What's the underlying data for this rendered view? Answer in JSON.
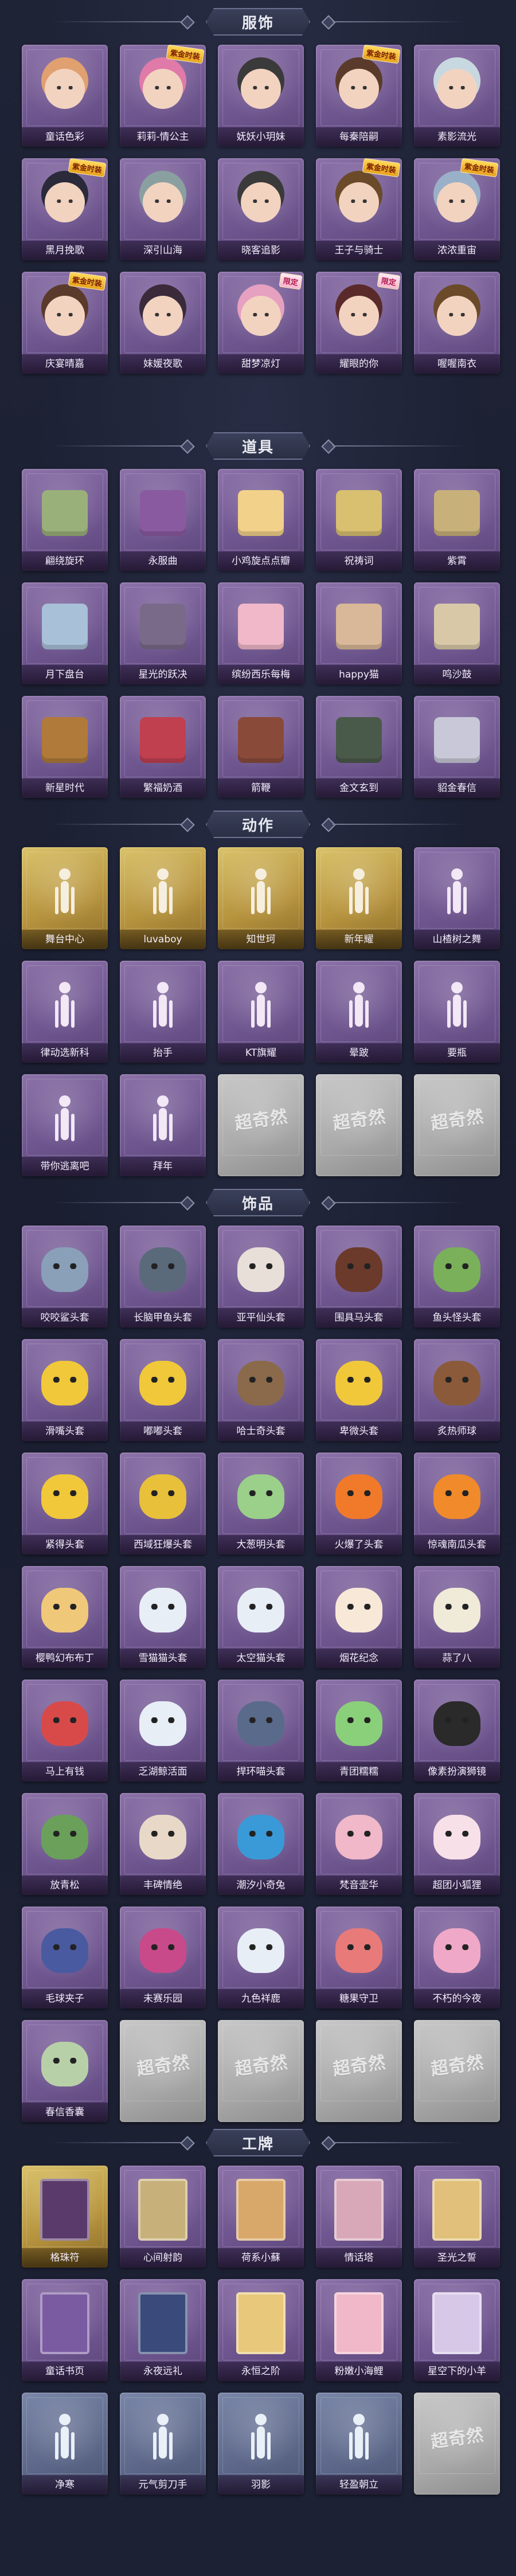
{
  "sections": [
    {
      "title": "服饰",
      "items": [
        {
          "label": "童话色彩",
          "style": "purple",
          "art": "face",
          "color": "#e0a070"
        },
        {
          "label": "莉莉-情公主",
          "style": "purple",
          "art": "face",
          "color": "#e07aa8",
          "badge": "紫金时装"
        },
        {
          "label": "妩妖小玥妹",
          "style": "purple",
          "art": "face",
          "color": "#3a3a3a"
        },
        {
          "label": "每秦陪嗣",
          "style": "purple",
          "art": "face",
          "color": "#5a3a2a",
          "badge": "紫金时装"
        },
        {
          "label": "素影流光",
          "style": "purple",
          "art": "face",
          "color": "#c8d8e0"
        },
        {
          "label": "黑月挽歌",
          "style": "purple",
          "art": "face",
          "color": "#2a2a3a",
          "badge": "紫金时装"
        },
        {
          "label": "深引山海",
          "style": "purple",
          "art": "face",
          "color": "#8aa0a0"
        },
        {
          "label": "晓客追影",
          "style": "purple",
          "art": "face",
          "color": "#3a3a3a"
        },
        {
          "label": "王子与骑士",
          "style": "purple",
          "art": "face",
          "color": "#6b4a2a",
          "badge": "紫金时装"
        },
        {
          "label": "浓浓重宙",
          "style": "purple",
          "art": "face",
          "color": "#9ab0c8",
          "badge": "紫金时装"
        },
        {
          "label": "庆宴晴嘉",
          "style": "purple",
          "art": "face",
          "color": "#5a3a2a",
          "badge": "紫金时装"
        },
        {
          "label": "妹媛夜歌",
          "style": "purple",
          "art": "face",
          "color": "#3a2a3a"
        },
        {
          "label": "甜梦凉灯",
          "style": "purple",
          "art": "face",
          "color": "#e6a0c0",
          "badge": "限定"
        },
        {
          "label": "耀眼的你",
          "style": "purple",
          "art": "face",
          "color": "#5a2a2a",
          "badge": "限定"
        },
        {
          "label": "喔喔南衣",
          "style": "purple",
          "art": "face",
          "color": "#6b4a2a"
        }
      ]
    },
    {
      "title": "道具",
      "items": [
        {
          "label": "翩绕旋环",
          "style": "purple",
          "art": "prop",
          "color": "#9ab07a"
        },
        {
          "label": "永服曲",
          "style": "purple",
          "art": "prop",
          "color": "#8a5aa0"
        },
        {
          "label": "小鸡旋点点瓣",
          "style": "purple",
          "art": "prop",
          "color": "#f2d28a"
        },
        {
          "label": "祝祷词",
          "style": "purple",
          "art": "prop",
          "color": "#d8c070"
        },
        {
          "label": "紫霄",
          "style": "purple",
          "art": "prop",
          "color": "#c8b07a"
        },
        {
          "label": "月下盘台",
          "style": "purple",
          "art": "prop",
          "color": "#a8c0d8"
        },
        {
          "label": "星光的跃决",
          "style": "purple",
          "art": "prop",
          "color": "#7a6a8a"
        },
        {
          "label": "缤纷西乐每梅",
          "style": "purple",
          "art": "prop",
          "color": "#f0b8c8"
        },
        {
          "label": "happy猫",
          "style": "purple",
          "art": "prop",
          "color": "#d8b898"
        },
        {
          "label": "鸣沙鼓",
          "style": "purple",
          "art": "prop",
          "color": "#d8c8a8"
        },
        {
          "label": "新星时代",
          "style": "purple",
          "art": "prop",
          "color": "#b07a3a"
        },
        {
          "label": "繁福奶酒",
          "style": "purple",
          "art": "prop",
          "color": "#c04050"
        },
        {
          "label": "箭鞭",
          "style": "purple",
          "art": "prop",
          "color": "#8a4a3a"
        },
        {
          "label": "金文玄到",
          "style": "purple",
          "art": "prop",
          "color": "#4a5a4a"
        },
        {
          "label": "貂金春信",
          "style": "purple",
          "art": "prop",
          "color": "#c8c8d8"
        }
      ]
    },
    {
      "title": "动作",
      "items": [
        {
          "label": "舞台中心",
          "style": "gold",
          "art": "pose",
          "color": "#f6efe0"
        },
        {
          "label": "luvaboy",
          "style": "gold",
          "art": "pose",
          "color": "#f6efe0"
        },
        {
          "label": "知世珂",
          "style": "gold",
          "art": "pose",
          "color": "#f6efe0"
        },
        {
          "label": "新年耀",
          "style": "gold",
          "art": "pose",
          "color": "#f6efe0"
        },
        {
          "label": "山楂树之舞",
          "style": "purple",
          "art": "pose",
          "color": "#f2e8f6"
        },
        {
          "label": "律动选新科",
          "style": "purple",
          "art": "pose",
          "color": "#f2e8f6"
        },
        {
          "label": "抬手",
          "style": "purple",
          "art": "pose",
          "color": "#f2e8f6"
        },
        {
          "label": "KT旗耀",
          "style": "purple",
          "art": "pose",
          "color": "#f2e8f6"
        },
        {
          "label": "晕跛",
          "style": "purple",
          "art": "pose",
          "color": "#f2e8f6"
        },
        {
          "label": "要瓶",
          "style": "purple",
          "art": "pose",
          "color": "#f2e8f6"
        },
        {
          "label": "带你逃离吧",
          "style": "purple",
          "art": "pose",
          "color": "#f2e8f6"
        },
        {
          "label": "拜年",
          "style": "purple",
          "art": "pose",
          "color": "#f2e8f6"
        },
        {
          "label": "",
          "style": "gray",
          "art": "wm",
          "wm": "超奇然"
        },
        {
          "label": "",
          "style": "gray",
          "art": "wm",
          "wm": "超奇然"
        },
        {
          "label": "",
          "style": "gray",
          "art": "wm",
          "wm": "超奇然"
        }
      ]
    },
    {
      "title": "饰品",
      "items": [
        {
          "label": "咬咬鲨头套",
          "style": "purple",
          "art": "mask",
          "color": "#8aa0b8"
        },
        {
          "label": "长脑甲鱼头套",
          "style": "purple",
          "art": "mask",
          "color": "#5a6a7a"
        },
        {
          "label": "亚平仙头套",
          "style": "purple",
          "art": "mask",
          "color": "#e8e0d8"
        },
        {
          "label": "围具马头套",
          "style": "purple",
          "art": "mask",
          "color": "#6b3a2a"
        },
        {
          "label": "鱼头怪头套",
          "style": "purple",
          "art": "mask",
          "color": "#7ab05a"
        },
        {
          "label": "滑嘴头套",
          "style": "purple",
          "art": "mask",
          "color": "#f0c83a"
        },
        {
          "label": "嘟嘟头套",
          "style": "purple",
          "art": "mask",
          "color": "#f0c83a"
        },
        {
          "label": "哈士奇头套",
          "style": "purple",
          "art": "mask",
          "color": "#8a6a4a"
        },
        {
          "label": "卑微头套",
          "style": "purple",
          "art": "mask",
          "color": "#f0c83a"
        },
        {
          "label": "炙热师球",
          "style": "purple",
          "art": "mask",
          "color": "#8a5a3a"
        },
        {
          "label": "紧得头套",
          "style": "purple",
          "art": "mask",
          "color": "#f0c83a"
        },
        {
          "label": "西域狂爆头套",
          "style": "purple",
          "art": "mask",
          "color": "#e8c03a"
        },
        {
          "label": "大葱明头套",
          "style": "purple",
          "art": "mask",
          "color": "#9ad08a"
        },
        {
          "label": "火爆了头套",
          "style": "purple",
          "art": "mask",
          "color": "#f07a2a"
        },
        {
          "label": "惊魂南瓜头套",
          "style": "purple",
          "art": "mask",
          "color": "#f08a2a"
        },
        {
          "label": "樱鸭幻布布丁",
          "style": "purple",
          "art": "mask",
          "color": "#f0c87a"
        },
        {
          "label": "雪猫猫头套",
          "style": "purple",
          "art": "mask",
          "color": "#e8eef6"
        },
        {
          "label": "太空猫头套",
          "style": "purple",
          "art": "mask",
          "color": "#e8eef6"
        },
        {
          "label": "烟花纪念",
          "style": "purple",
          "art": "mask",
          "color": "#f8e8d8"
        },
        {
          "label": "蒜了八",
          "style": "purple",
          "art": "mask",
          "color": "#f0ead8"
        },
        {
          "label": "马上有钱",
          "style": "purple",
          "art": "mask",
          "color": "#d84a4a"
        },
        {
          "label": "乏湖鲸活面",
          "style": "purple",
          "art": "mask",
          "color": "#e8eef6"
        },
        {
          "label": "捍环喵头套",
          "style": "purple",
          "art": "mask",
          "color": "#5a6a8a"
        },
        {
          "label": "青团糯糯",
          "style": "purple",
          "art": "mask",
          "color": "#8ad07a"
        },
        {
          "label": "像素扮演狮镜",
          "style": "purple",
          "art": "mask",
          "color": "#2a2a2a"
        },
        {
          "label": "放青松",
          "style": "purple",
          "art": "mask",
          "color": "#6aa05a"
        },
        {
          "label": "丰碑情绝",
          "style": "purple",
          "art": "mask",
          "color": "#e8d8c8"
        },
        {
          "label": "潮汐小奇兔",
          "style": "purple",
          "art": "mask",
          "color": "#3a9ad8"
        },
        {
          "label": "梵音壶华",
          "style": "purple",
          "art": "mask",
          "color": "#f0b8c8"
        },
        {
          "label": "超团小狐狸",
          "style": "purple",
          "art": "mask",
          "color": "#f8e0e8"
        },
        {
          "label": "毛球夹子",
          "style": "purple",
          "art": "mask",
          "color": "#4a5aa0"
        },
        {
          "label": "未赛乐园",
          "style": "purple",
          "art": "mask",
          "color": "#c84a8a"
        },
        {
          "label": "九色祥鹿",
          "style": "purple",
          "art": "mask",
          "color": "#e8eef6"
        },
        {
          "label": "糖果守卫",
          "style": "purple",
          "art": "mask",
          "color": "#e87a7a"
        },
        {
          "label": "不朽的今夜",
          "style": "purple",
          "art": "mask",
          "color": "#f0a8c8"
        },
        {
          "label": "春信香囊",
          "style": "purple",
          "art": "mask",
          "color": "#b8d0a8"
        },
        {
          "label": "",
          "style": "gray",
          "art": "wm",
          "wm": "超奇然"
        },
        {
          "label": "",
          "style": "gray",
          "art": "wm",
          "wm": "超奇然"
        },
        {
          "label": "",
          "style": "gray",
          "art": "wm",
          "wm": "超奇然"
        },
        {
          "label": "",
          "style": "gray",
          "art": "wm",
          "wm": "超奇然"
        }
      ]
    },
    {
      "title": "工牌",
      "items": [
        {
          "label": "格珠符",
          "style": "gold",
          "art": "cardart",
          "color": "#5a3a6a"
        },
        {
          "label": "心间射韵",
          "style": "purple",
          "art": "cardart",
          "color": "#c8b07a"
        },
        {
          "label": "荷系小蘇",
          "style": "purple",
          "art": "cardart",
          "color": "#d8a86a"
        },
        {
          "label": "情话塔",
          "style": "purple",
          "art": "cardart",
          "color": "#d8a8b8"
        },
        {
          "label": "圣光之誓",
          "style": "purple",
          "art": "cardart",
          "color": "#e0c07a"
        },
        {
          "label": "童话书页",
          "style": "purple",
          "art": "cardart",
          "color": "#7a5aa0"
        },
        {
          "label": "永夜远礼",
          "style": "purple",
          "art": "cardart",
          "color": "#3a4a7a"
        },
        {
          "label": "永恒之阶",
          "style": "purple",
          "art": "cardart",
          "color": "#e8c87a"
        },
        {
          "label": "粉嫩小海鲤",
          "style": "purple",
          "art": "cardart",
          "color": "#f0b8c8"
        },
        {
          "label": "星空下的小羊",
          "style": "purple",
          "art": "cardart",
          "color": "#d8c8e8"
        },
        {
          "label": "净寒",
          "style": "slate",
          "art": "pose",
          "color": "#eaf0f8"
        },
        {
          "label": "元气剪刀手",
          "style": "slate",
          "art": "pose",
          "color": "#eaf0f8"
        },
        {
          "label": "羽影",
          "style": "slate",
          "art": "pose",
          "color": "#eaf0f8"
        },
        {
          "label": "轻盈朝立",
          "style": "slate",
          "art": "pose",
          "color": "#eaf0f8"
        },
        {
          "label": "",
          "style": "gray",
          "art": "wm",
          "wm": "超奇然"
        }
      ]
    }
  ]
}
